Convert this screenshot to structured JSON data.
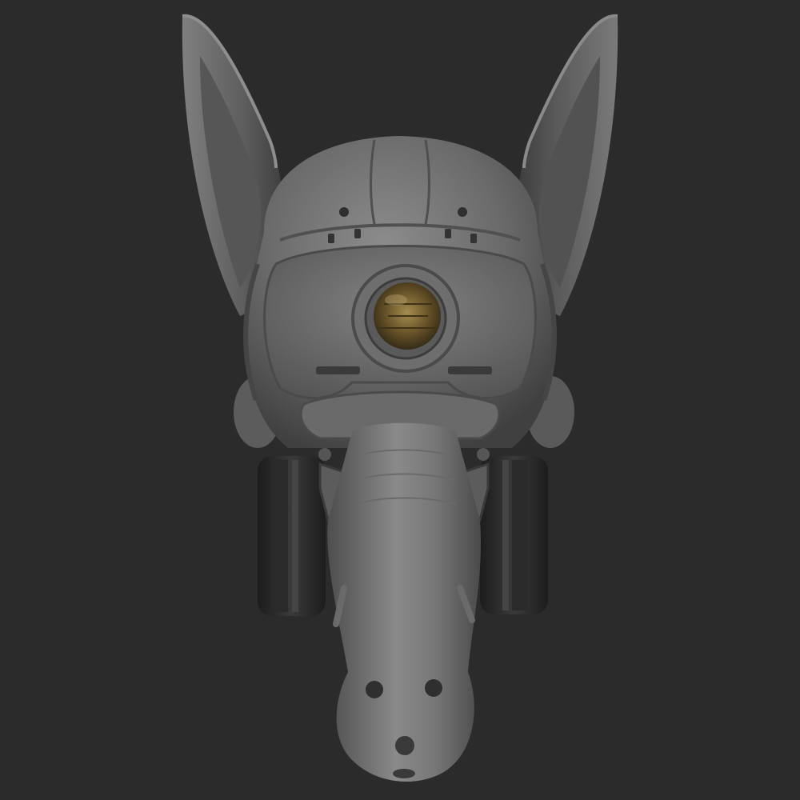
{
  "scene": {
    "subject": "sculpted-mask-render",
    "colors": {
      "background": "#2b2b2c",
      "clay_light": "#8a8a8a",
      "clay_mid": "#6b6b6b",
      "clay_dark": "#3e3e3e",
      "filter_dark": "#1f1f1f",
      "lens_tint": "#6e5a2e"
    }
  }
}
